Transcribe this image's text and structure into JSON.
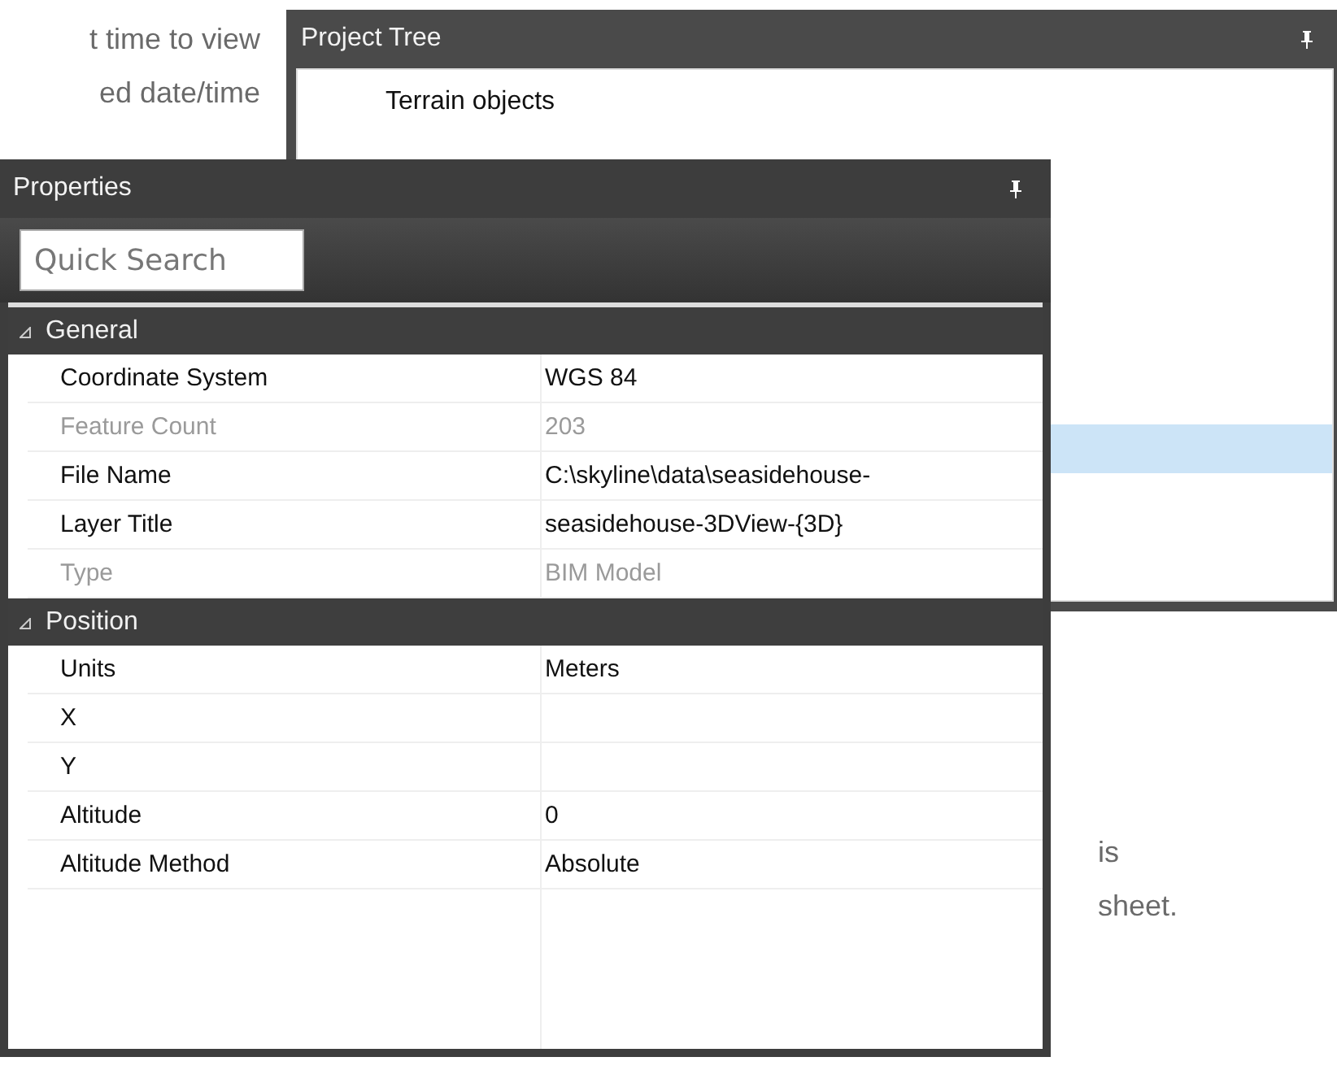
{
  "background_text": {
    "top_lines": [
      "t time to view",
      "ed date/time"
    ],
    "bottom_lines": [
      "is",
      "sheet."
    ]
  },
  "project_tree": {
    "title": "Project Tree",
    "items": [
      {
        "label": "Terrain objects",
        "selected": false
      },
      {
        "selected": true
      }
    ]
  },
  "properties": {
    "title": "Properties",
    "search": {
      "placeholder": "Quick Search"
    },
    "categories": [
      {
        "name": "General",
        "expanded": true,
        "rows": [
          {
            "name": "Coordinate System",
            "value": "WGS 84",
            "disabled": false
          },
          {
            "name": "Feature Count",
            "value": "203",
            "disabled": true
          },
          {
            "name": "File Name",
            "value": "C:\\skyline\\data\\seasidehouse-",
            "disabled": false
          },
          {
            "name": "Layer Title",
            "value": "seasidehouse-3DView-{3D}",
            "disabled": false
          },
          {
            "name": "Type",
            "value": "BIM Model",
            "disabled": true
          }
        ]
      },
      {
        "name": "Position",
        "expanded": true,
        "rows": [
          {
            "name": "Units",
            "value": "Meters",
            "disabled": false
          },
          {
            "name": "X",
            "disabled": false
          },
          {
            "name": "Y",
            "disabled": false
          },
          {
            "name": "Altitude",
            "value": "0",
            "disabled": false
          },
          {
            "name": "Altitude Method",
            "value": "Absolute",
            "disabled": false
          }
        ]
      }
    ]
  }
}
